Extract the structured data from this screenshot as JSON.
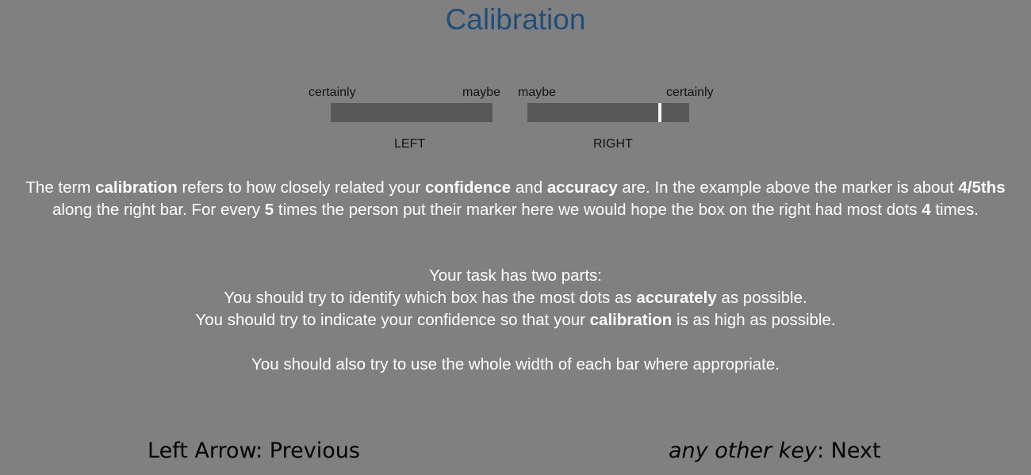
{
  "title": "Calibration",
  "example": {
    "left_scale": {
      "outer_label": "certainly",
      "inner_label": "maybe",
      "side": "LEFT"
    },
    "right_scale": {
      "inner_label": "maybe",
      "outer_label": "certainly",
      "side": "RIGHT"
    },
    "marker_position_fraction": 0.82,
    "colors": {
      "bar": "#585858",
      "marker": "#f4f4f4",
      "title": "#1f4e79",
      "background": "#808080"
    }
  },
  "paragraph1": [
    {
      "text": "The term ",
      "bold": false
    },
    {
      "text": "calibration",
      "bold": true
    },
    {
      "text": " refers to how closely related your ",
      "bold": false
    },
    {
      "text": "confidence",
      "bold": true
    },
    {
      "text": " and ",
      "bold": false
    },
    {
      "text": "accuracy",
      "bold": true
    },
    {
      "text": " are. In the example above the marker is about ",
      "bold": false
    },
    {
      "text": "4/5ths",
      "bold": true
    },
    {
      "text": " along the right bar. For every ",
      "bold": false
    },
    {
      "text": "5",
      "bold": true
    },
    {
      "text": " times the person put their marker here we would hope the box on the right had most dots ",
      "bold": false
    },
    {
      "text": "4",
      "bold": true
    },
    {
      "text": " times.",
      "bold": false
    }
  ],
  "task": {
    "heading": "Your task has two parts:",
    "line1": [
      {
        "text": "You should try to identify which box has the most dots as ",
        "bold": false
      },
      {
        "text": "accurately",
        "bold": true
      },
      {
        "text": " as possible.",
        "bold": false
      }
    ],
    "line2": [
      {
        "text": "You should try to indicate your confidence so that your ",
        "bold": false
      },
      {
        "text": "calibration",
        "bold": true
      },
      {
        "text": " is as high as possible.",
        "bold": false
      }
    ]
  },
  "footer_note": "You should also try to use the whole width of each bar where appropriate.",
  "nav": {
    "prev_key": "Left Arrow",
    "prev_action": ": Previous",
    "next_key": "any other key",
    "next_action": ": Next"
  }
}
